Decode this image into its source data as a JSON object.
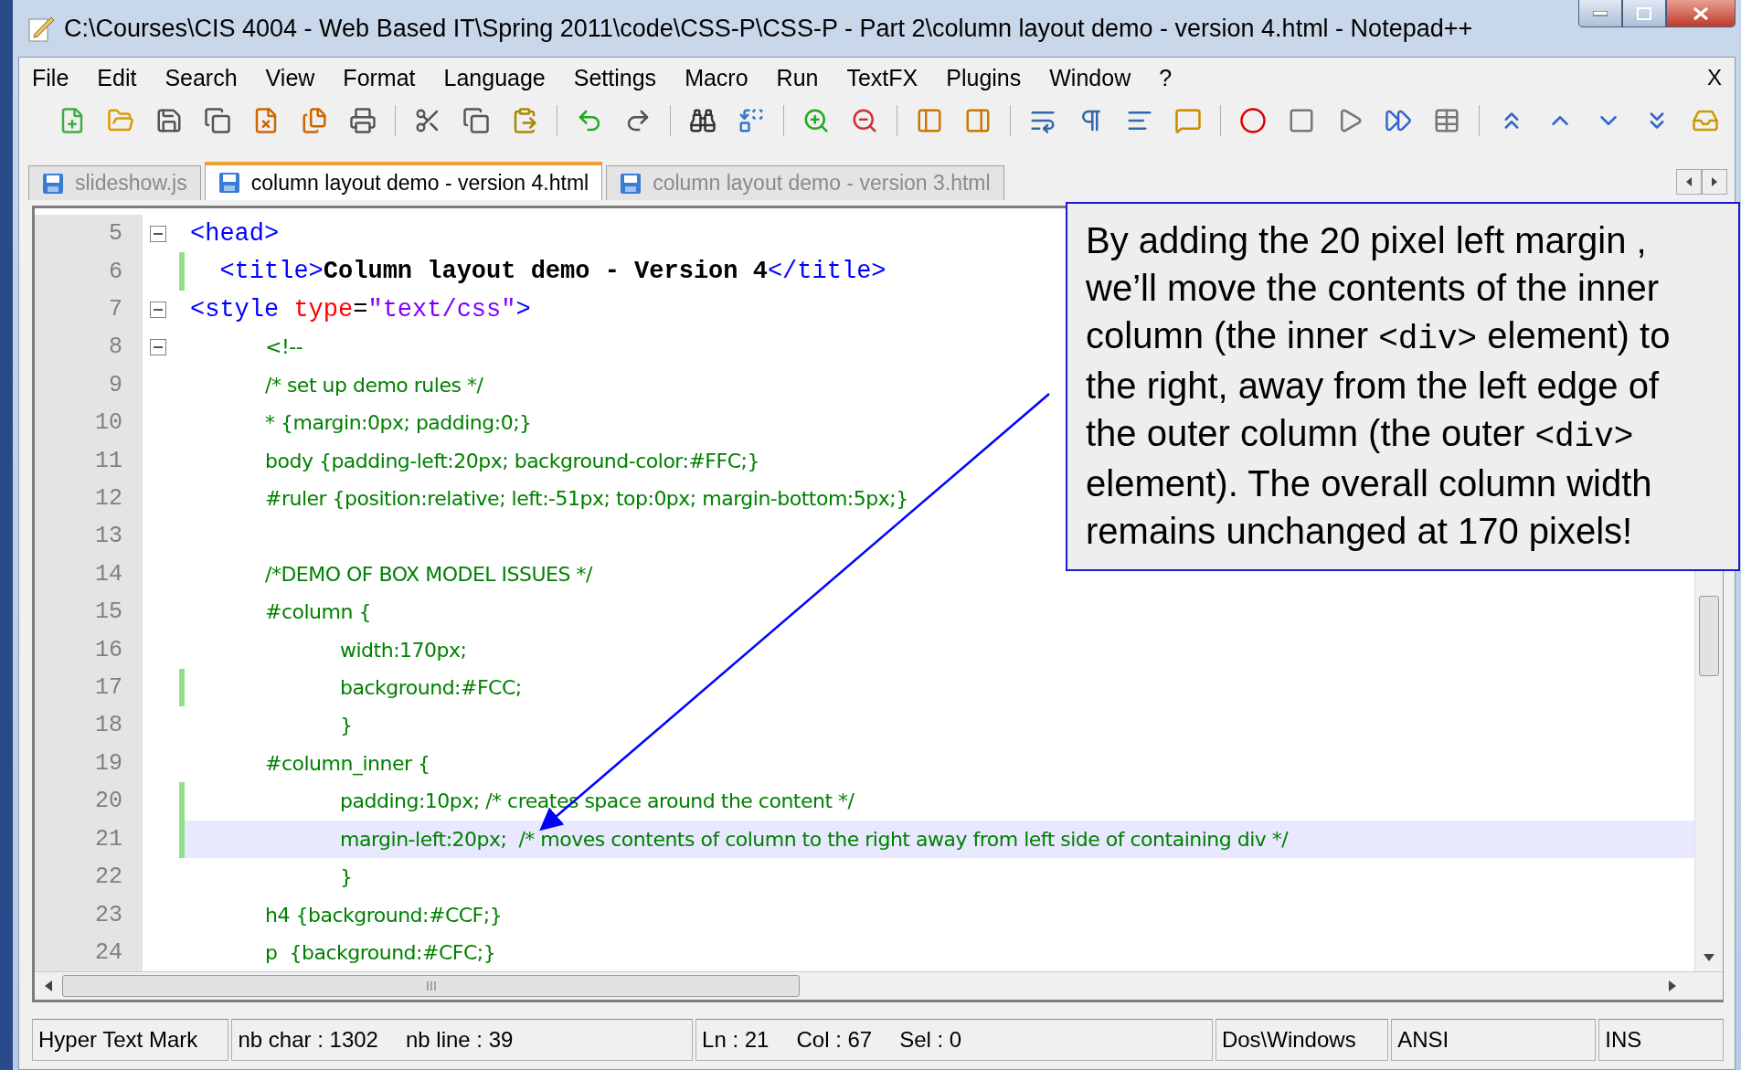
{
  "window": {
    "title": "C:\\Courses\\CIS 4004 - Web Based IT\\Spring 2011\\code\\CSS-P\\CSS-P - Part 2\\column layout demo - version 4.html - Notepad++"
  },
  "menu": {
    "items": [
      "File",
      "Edit",
      "Search",
      "View",
      "Format",
      "Language",
      "Settings",
      "Macro",
      "Run",
      "TextFX",
      "Plugins",
      "Window",
      "?"
    ],
    "close": "X"
  },
  "tabs": [
    {
      "label": "slideshow.js",
      "selected": false
    },
    {
      "label": "column layout demo - version 4.html",
      "selected": true
    },
    {
      "label": "column layout demo - version 3.html",
      "selected": false
    }
  ],
  "editor": {
    "lines": [
      {
        "number": "5",
        "fold": true,
        "changed": false,
        "selected": false,
        "segments": [
          {
            "kind": "tag",
            "text": "<head>"
          }
        ]
      },
      {
        "number": "6",
        "fold": false,
        "changed": true,
        "selected": false,
        "segments": [
          {
            "kind": "tag",
            "text": "  <title>"
          },
          {
            "kind": "bold",
            "text": "Column layout demo - Version 4"
          },
          {
            "kind": "tag",
            "text": "</title>"
          }
        ]
      },
      {
        "number": "7",
        "fold": true,
        "changed": false,
        "selected": false,
        "segments": [
          {
            "kind": "tag",
            "text": "<style "
          },
          {
            "kind": "attr",
            "text": "type"
          },
          {
            "kind": "plain",
            "text": "="
          },
          {
            "kind": "string",
            "text": "\"text/css\""
          },
          {
            "kind": "tag",
            "text": ">"
          }
        ]
      },
      {
        "number": "8",
        "fold": true,
        "changed": false,
        "selected": false,
        "segments": [
          {
            "kind": "comment",
            "text": "\t<!--"
          }
        ]
      },
      {
        "number": "9",
        "fold": false,
        "changed": false,
        "selected": false,
        "segments": [
          {
            "kind": "comment",
            "text": "\t/* set up demo rules */"
          }
        ]
      },
      {
        "number": "10",
        "fold": false,
        "changed": false,
        "selected": false,
        "segments": [
          {
            "kind": "comment",
            "text": "\t* {margin:0px; padding:0;}"
          }
        ]
      },
      {
        "number": "11",
        "fold": false,
        "changed": false,
        "selected": false,
        "segments": [
          {
            "kind": "comment",
            "text": "\tbody {padding-left:20px; background-color:#FFC;}"
          }
        ]
      },
      {
        "number": "12",
        "fold": false,
        "changed": false,
        "selected": false,
        "segments": [
          {
            "kind": "comment",
            "text": "\t#ruler {position:relative; left:-51px; top:0px; margin-bottom:5px;}"
          }
        ]
      },
      {
        "number": "13",
        "fold": false,
        "changed": false,
        "selected": false
      },
      {
        "number": "14",
        "fold": false,
        "changed": false,
        "selected": false,
        "segments": [
          {
            "kind": "comment",
            "text": "\t/*DEMO OF BOX MODEL ISSUES */"
          }
        ]
      },
      {
        "number": "15",
        "fold": false,
        "changed": false,
        "selected": false,
        "segments": [
          {
            "kind": "comment",
            "text": "\t#column {"
          }
        ]
      },
      {
        "number": "16",
        "fold": false,
        "changed": false,
        "selected": false,
        "segments": [
          {
            "kind": "comment",
            "text": "\t\twidth:170px;"
          }
        ]
      },
      {
        "number": "17",
        "fold": false,
        "changed": true,
        "selected": false,
        "segments": [
          {
            "kind": "comment",
            "text": "\t\tbackground:#FCC;"
          }
        ]
      },
      {
        "number": "18",
        "fold": false,
        "changed": false,
        "selected": false,
        "segments": [
          {
            "kind": "comment",
            "text": "\t\t}"
          }
        ]
      },
      {
        "number": "19",
        "fold": false,
        "changed": false,
        "selected": false,
        "segments": [
          {
            "kind": "comment",
            "text": "\t#column_inner {"
          }
        ]
      },
      {
        "number": "20",
        "fold": false,
        "changed": true,
        "selected": false,
        "segments": [
          {
            "kind": "comment",
            "text": "\t\tpadding:10px; /* creates space around the content */"
          }
        ]
      },
      {
        "number": "21",
        "fold": false,
        "changed": true,
        "selected": true,
        "segments": [
          {
            "kind": "comment",
            "text": "\t\tmargin-left:20px;  /* moves contents of column to the right away from left side of containing div */"
          }
        ]
      },
      {
        "number": "22",
        "fold": false,
        "changed": false,
        "selected": false,
        "segments": [
          {
            "kind": "comment",
            "text": "\t\t}"
          }
        ]
      },
      {
        "number": "23",
        "fold": false,
        "changed": false,
        "selected": false,
        "segments": [
          {
            "kind": "comment",
            "text": "\th4 {background:#CCF;}"
          }
        ]
      },
      {
        "number": "24",
        "fold": false,
        "changed": false,
        "selected": false,
        "segments": [
          {
            "kind": "comment",
            "text": "\tp  {background:#CFC;}"
          }
        ]
      }
    ]
  },
  "callout": {
    "segments": [
      {
        "kind": "prose",
        "text": "By adding the 20 pixel left margin , we’ll move the contents of the inner column (the inner "
      },
      {
        "kind": "code",
        "text": "<div>"
      },
      {
        "kind": "prose",
        "text": " element) to the right, away from the left edge of the outer column (the outer "
      },
      {
        "kind": "code",
        "text": "<div>"
      },
      {
        "kind": "prose",
        "text": " element).  The overall column width remains unchanged at 170 pixels!"
      }
    ]
  },
  "status_bar": [
    {
      "items": [
        "Hyper Text Mark"
      ]
    },
    {
      "items": [
        "nb char : 1302",
        "nb line : 39"
      ]
    },
    {
      "items": [
        "Ln : 21",
        "Col : 67",
        "Sel : 0"
      ]
    },
    {
      "items": [
        "Dos\\Windows"
      ]
    },
    {
      "items": [
        "ANSI"
      ]
    },
    {
      "items": [
        "INS"
      ]
    }
  ]
}
